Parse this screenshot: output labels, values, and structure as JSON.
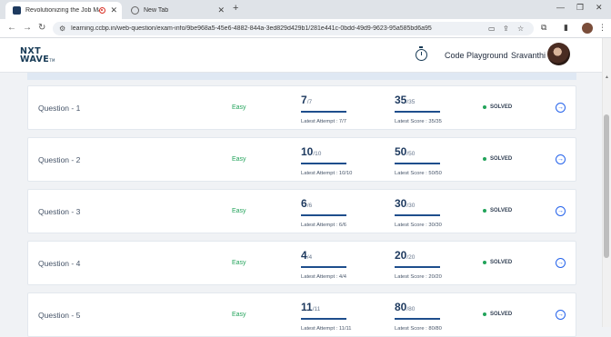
{
  "browser": {
    "tabs": [
      {
        "title": "Revolutionizing the Job Ma"
      },
      {
        "title": "New Tab"
      }
    ],
    "url": "learning.ccbp.in/web-question/exam-info/9be968a5-45e6-4882-844a-3ed829d429b1/281e441c-0bdd-49d9-9623-95a585bd6a95"
  },
  "header": {
    "logo_top": "NXT",
    "logo_bottom": "WAVE",
    "logo_tm": "TM",
    "code_playground": "Code Playground",
    "user_name": "Sravanthi"
  },
  "questions": [
    {
      "name": "Question - 1",
      "difficulty": "Easy",
      "tests_passed": "7",
      "tests_total": "/7",
      "tests_latest": "Latest Attempt : 7/7",
      "score": "35",
      "score_total": "/35",
      "score_latest": "Latest Score : 35/35",
      "status": "SOLVED"
    },
    {
      "name": "Question - 2",
      "difficulty": "Easy",
      "tests_passed": "10",
      "tests_total": "/10",
      "tests_latest": "Latest Attempt : 10/10",
      "score": "50",
      "score_total": "/50",
      "score_latest": "Latest Score : 50/50",
      "status": "SOLVED"
    },
    {
      "name": "Question - 3",
      "difficulty": "Easy",
      "tests_passed": "6",
      "tests_total": "/6",
      "tests_latest": "Latest Attempt : 6/6",
      "score": "30",
      "score_total": "/30",
      "score_latest": "Latest Score : 30/30",
      "status": "SOLVED"
    },
    {
      "name": "Question - 4",
      "difficulty": "Easy",
      "tests_passed": "4",
      "tests_total": "/4",
      "tests_latest": "Latest Attempt : 4/4",
      "score": "20",
      "score_total": "/20",
      "score_latest": "Latest Score : 20/20",
      "status": "SOLVED"
    },
    {
      "name": "Question - 5",
      "difficulty": "Easy",
      "tests_passed": "11",
      "tests_total": "/11",
      "tests_latest": "Latest Attempt : 11/11",
      "score": "80",
      "score_total": "/80",
      "score_latest": "Latest Score : 80/80",
      "status": "SOLVED"
    }
  ],
  "progress_fraction": 1.0,
  "colors": {
    "accent": "#1e4e8c",
    "easy": "#22a35a",
    "solved_dot": "#22a35a",
    "link": "#2563eb"
  }
}
